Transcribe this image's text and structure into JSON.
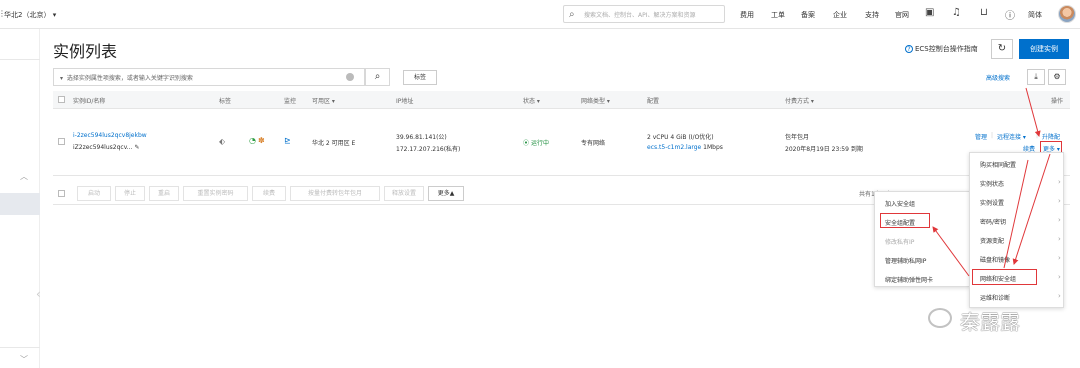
{
  "topbar": {
    "region": "华北2（北京）",
    "search_placeholder": "搜索文档、控制台、API、解决方案和资源",
    "nav": [
      "费用",
      "工单",
      "备案",
      "企业",
      "支持",
      "官网"
    ],
    "lang": "简体"
  },
  "page": {
    "title": "实例列表",
    "guide": "ECS控制台操作指南",
    "create_label": "创建实例",
    "filter_placeholder": "选择实例属性项搜索，或者输入关键字识别搜索",
    "tag_label": "标签",
    "advanced_search": "高级搜索"
  },
  "table": {
    "headers": [
      "实例ID/名称",
      "标签",
      "监控",
      "可用区",
      "IP地址",
      "状态",
      "网络类型",
      "配置",
      "付费方式",
      "操作"
    ],
    "row": {
      "id": "i-2zec594lus2qcv8jekbw",
      "name": "iZ2zec594lus2qcv...",
      "zone": "华北 2 可用区 E",
      "ip_public": "39.96.81.141(公)",
      "ip_private": "172.17.207.216(私有)",
      "status": "运行中",
      "network": "专有网络",
      "config_line1": "2 vCPU 4 GiB (I/O优化)",
      "config_type": "ecs.t5-c1m2.large",
      "config_bw": "1Mbps",
      "billing_line1": "包年包月",
      "billing_line2": "2020年8月19日 23:59 到期",
      "op_manage": "管理",
      "op_remote": "远程连接",
      "op_upgrade": "升降配",
      "op_renew": "续费",
      "op_more": "更多"
    }
  },
  "footer": {
    "buttons": [
      "启动",
      "停止",
      "重启",
      "重置实例密码",
      "续费",
      "按量付费转包年包月",
      "释放设置"
    ],
    "more_label": "更多▲",
    "pagination": "共有1条，每页显示："
  },
  "submenu": {
    "items": [
      "加入安全组",
      "安全组配置",
      "修改私有IP",
      "管理辅助私网IP",
      "绑定辅助弹性网卡"
    ]
  },
  "moremenu": {
    "items": [
      "购买相同配置",
      "实例状态",
      "实例设置",
      "密码/密钥",
      "资源变配",
      "磁盘和镜像",
      "网络和安全组",
      "运维和诊断"
    ]
  },
  "watermark": "秦露露",
  "colors": {
    "accent": "#0070cc",
    "highlight": "#e0373a",
    "status_running": "#1e8e3e"
  }
}
